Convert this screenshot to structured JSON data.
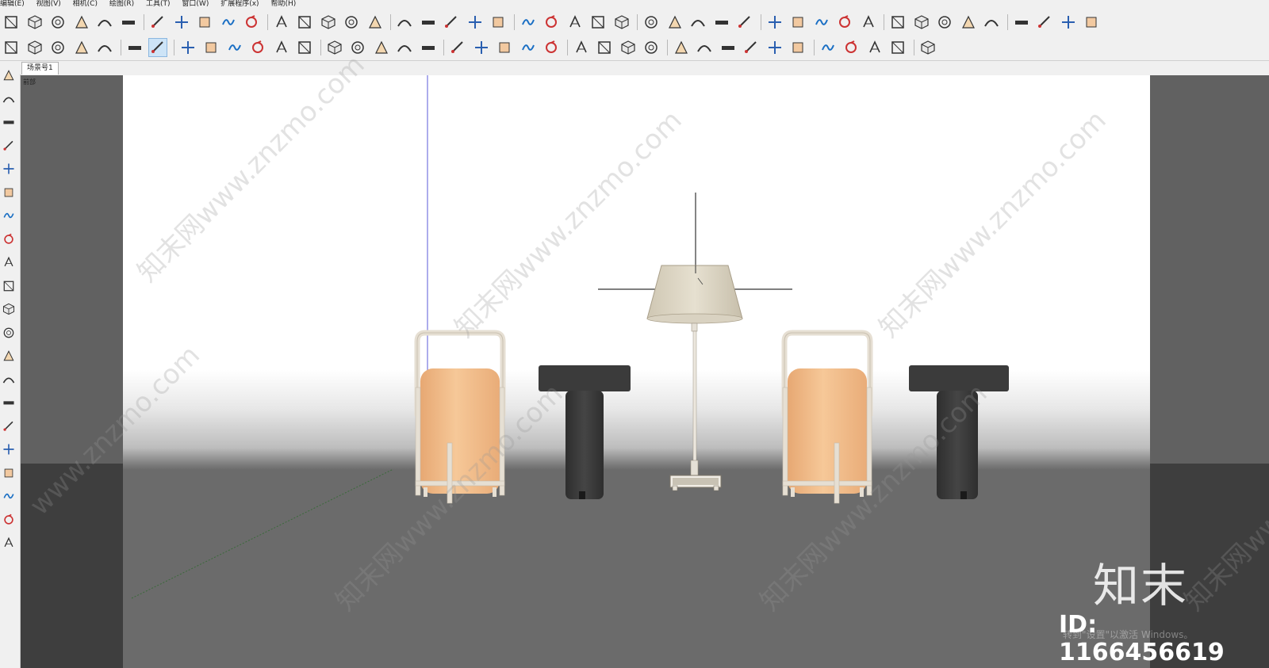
{
  "menu": {
    "items": [
      "编辑(E)",
      "视图(V)",
      "相机(C)",
      "绘图(R)",
      "工具(T)",
      "窗口(W)",
      "扩展程序(x)",
      "帮助(H)"
    ]
  },
  "scene_tabs": {
    "active": "场景号1"
  },
  "viewport": {
    "label": "前部"
  },
  "watermarks": [
    "知末网www.znzmo.com",
    "知末网www.znzmo.com",
    "知末网www.znzmo.com",
    "知末网www.znzmo.com",
    "知末网www.znzmo.com",
    "知末网www.znzmo.com",
    "www.znzmo.com",
    "知末网"
  ],
  "brand": {
    "name": "知末",
    "id_label": "ID: 1166456619"
  },
  "os_overlay": {
    "text": "转到\"设置\"以激活 Windows。"
  },
  "colors": {
    "toolbar_bg": "#f0f0f0",
    "viewport_sky": "#ffffff",
    "viewport_ground": "#6b6b6b",
    "lantern_body": "#f0bd8a",
    "lantern_frame": "#ece6dc",
    "side_table": "#3a3a3a",
    "lamp_shade": "#dcd6c6"
  },
  "icons": {
    "toolbar1": [
      "select-filter-icon",
      "iso-view-icon",
      "top-view-icon",
      "front-view-icon",
      "right-view-icon",
      "back-view-icon",
      "left-view-icon",
      "section-icon",
      "follow-me-icon",
      "box-icon",
      "push-pull-icon",
      "dynamic-icon",
      "shell-icon",
      "grid-icon",
      "stack-icon",
      "match-photo-icon",
      "solid-tools-icon",
      "intersect-icon",
      "union-icon",
      "subtract-icon",
      "trim-icon",
      "split-icon",
      "round-corner-icon",
      "extrude-icon",
      "stair-icon",
      "ladder-icon",
      "bar-chart-icon",
      "weld-icon",
      "line-tool-icon",
      "curve-icon",
      "angle-icon",
      "arc-icon",
      "loop-icon",
      "connect-icon",
      "pipe-icon",
      "edge-icon",
      "layers-icon",
      "cube-icon",
      "spiral-icon",
      "mirror-icon",
      "chair-icon",
      "columns-icon",
      "triangle-icon",
      "dots-icon",
      "panel-icon"
    ],
    "toolbar2": [
      "component-icon",
      "home-icon",
      "warehouse-icon",
      "house-icon",
      "garage-icon",
      "zoom-icon",
      "select-arrow-icon",
      "eraser-icon",
      "pencil-icon",
      "freehand-icon",
      "circle-icon",
      "push-pull-tool-icon",
      "follow-tool-icon",
      "move-icon",
      "rotate-icon",
      "scale-icon",
      "tape-icon",
      "text-icon",
      "paint-icon",
      "orbit-icon",
      "pan-icon",
      "zoom-tool-icon",
      "zoom-extents-icon",
      "position-camera-icon",
      "walk-icon",
      "look-around-icon",
      "sandbox-icon",
      "profile-icon",
      "style-icon",
      "materials-icon",
      "render-icon",
      "tea-icon",
      "sunflower-icon",
      "refresh-icon",
      "window-icon",
      "window2-icon",
      "window3-icon",
      "window4-icon"
    ],
    "left": [
      "orbit-icon",
      "eraser-icon",
      "tape-icon",
      "freehand-icon",
      "rectangle-icon",
      "circle-icon",
      "arc-icon",
      "polygon-icon",
      "push-pull-icon",
      "follow-me-icon",
      "rotate-icon",
      "move-icon",
      "text-icon",
      "section-plane-icon",
      "pan-icon",
      "zoom-icon",
      "paint-bucket-icon",
      "look-around-icon",
      "walk-icon",
      "sandbox-icon",
      "sandbox2-icon"
    ]
  }
}
